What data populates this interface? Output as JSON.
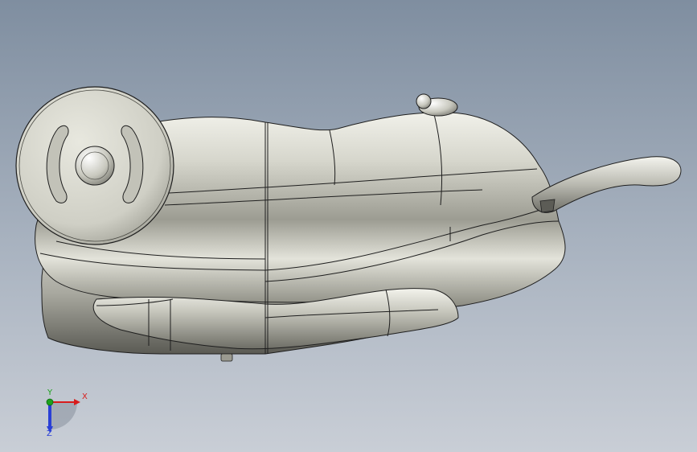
{
  "viewport": {
    "background_top": "#7f8ea0",
    "background_bottom": "#c9ced6"
  },
  "model": {
    "description_icon": "cad-part-shaded",
    "body_color": "#d8d8cf",
    "edge_color": "#1e1e1e"
  },
  "triad": {
    "x_label": "X",
    "y_label": "Y",
    "z_label": "Z",
    "x_color": "#d81c1c",
    "y_color": "#1da11d",
    "z_color": "#2a3fd6"
  }
}
